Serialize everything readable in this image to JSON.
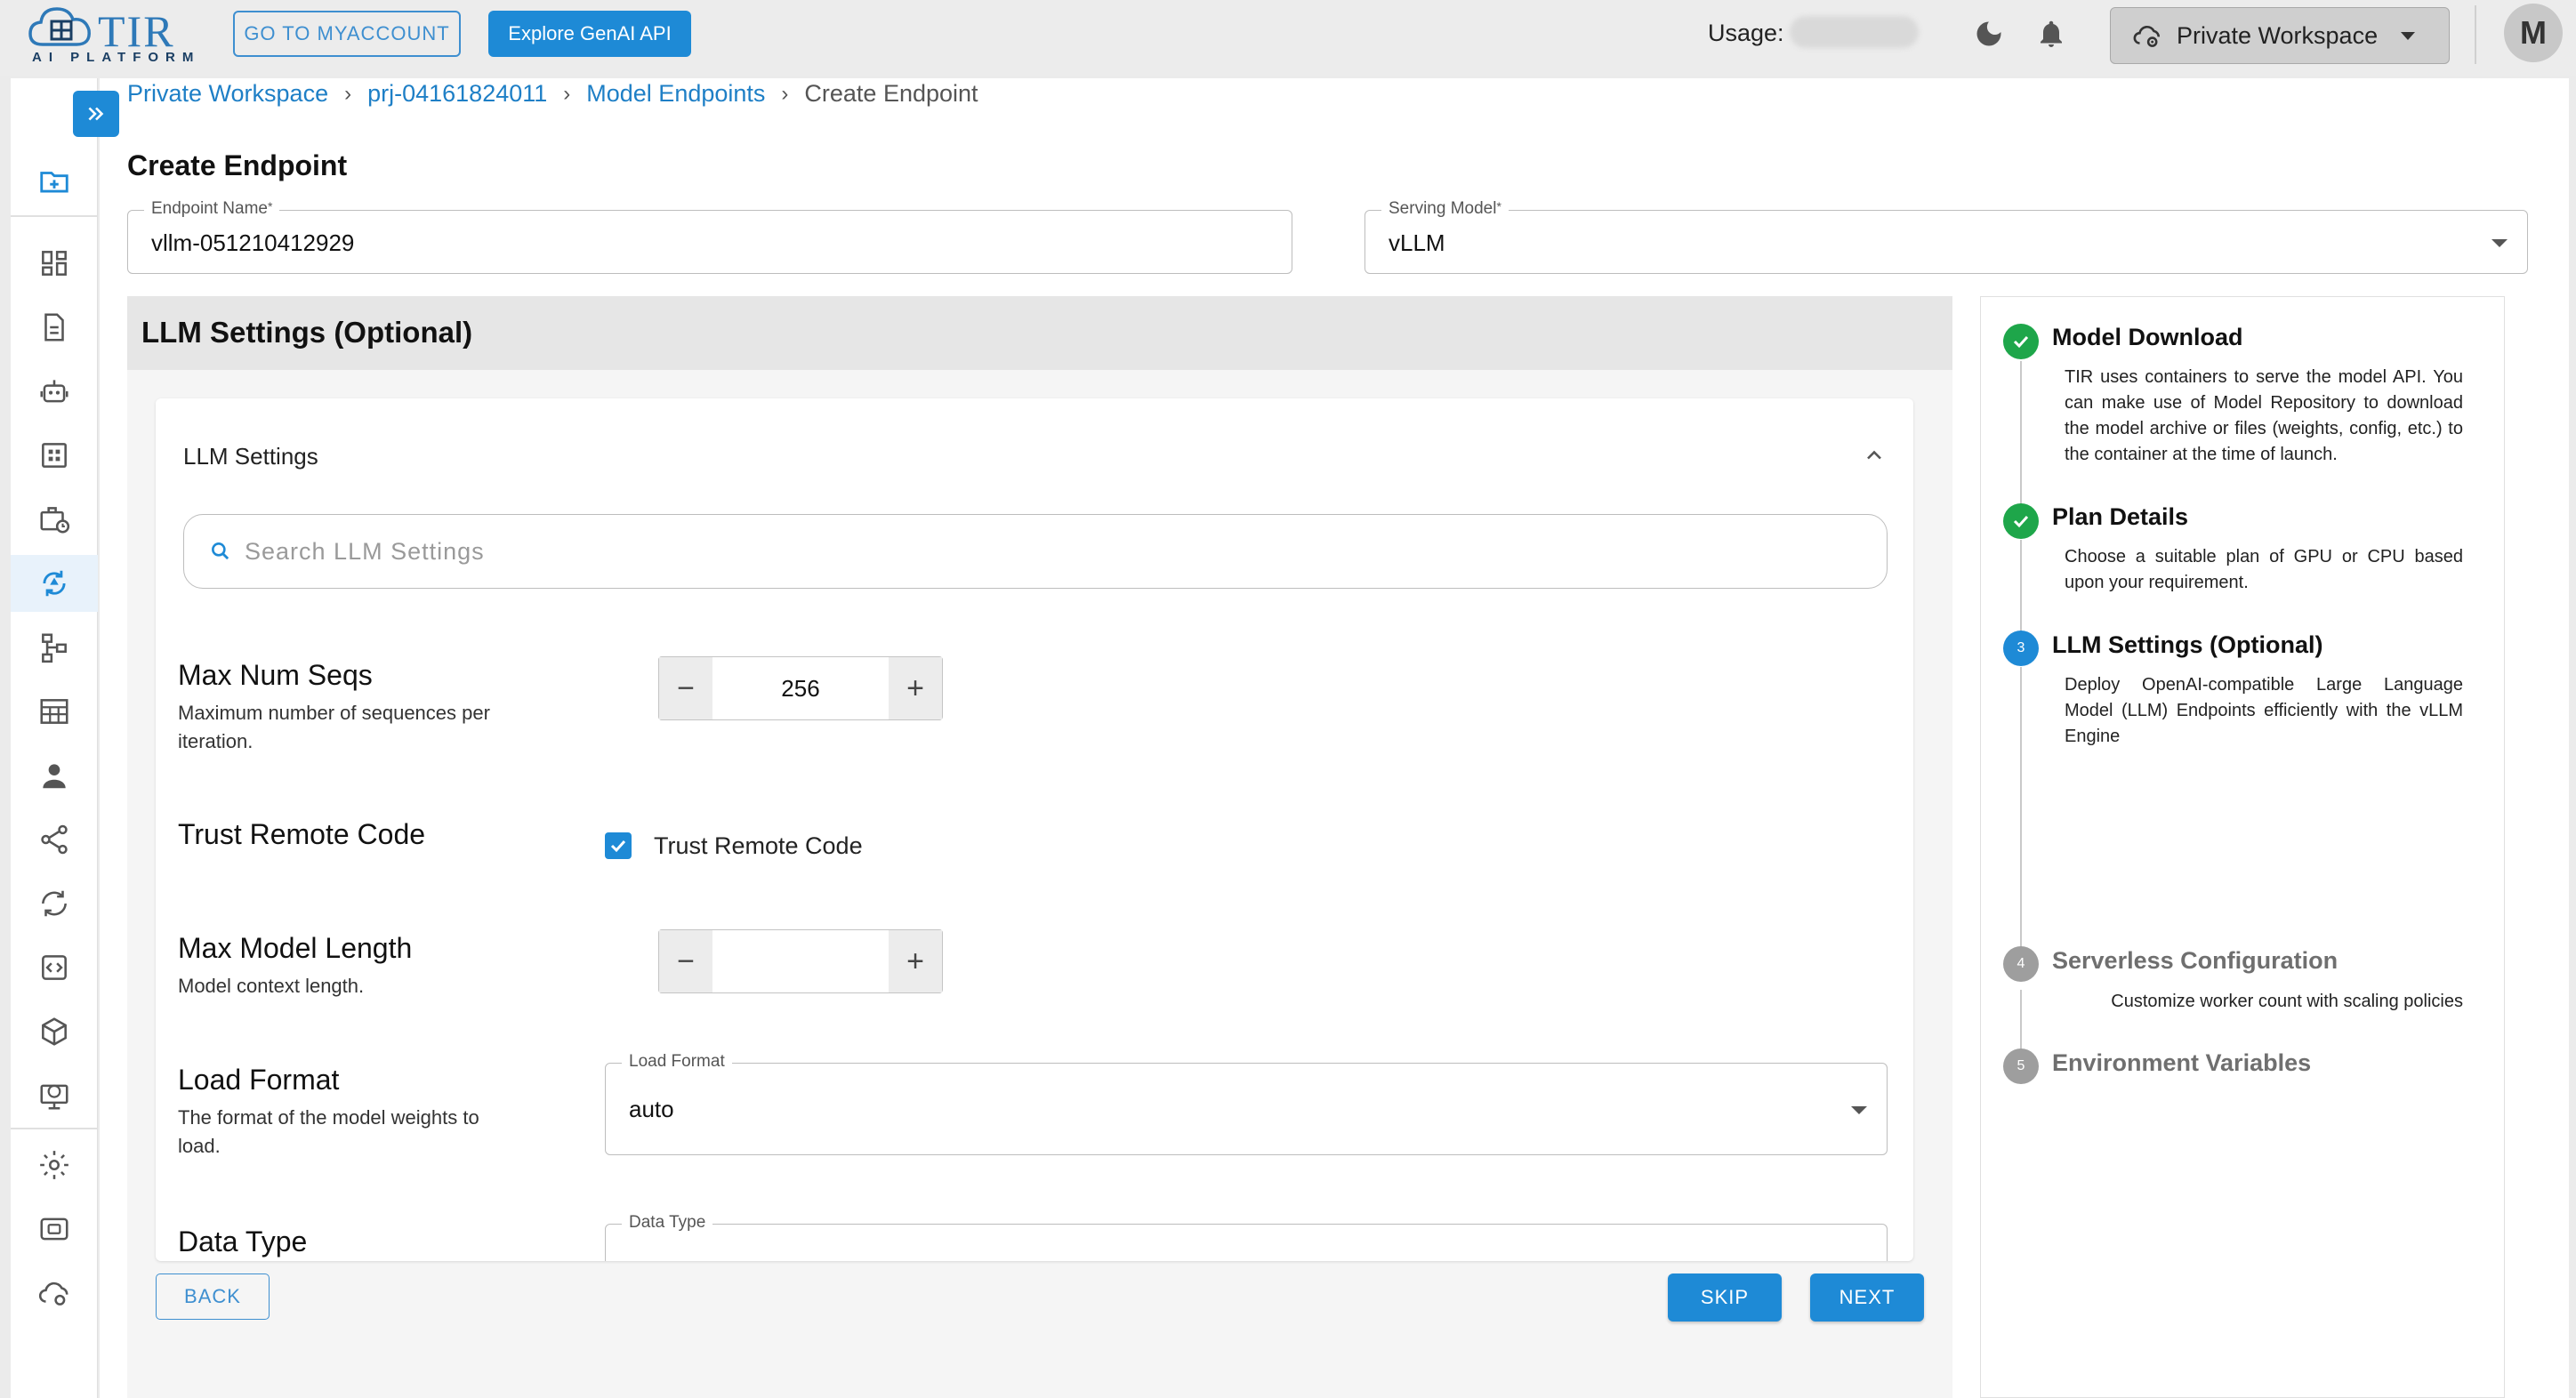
{
  "topbar": {
    "logo_title": "TIR",
    "logo_subtitle": "AI PLATFORM",
    "myaccount_label": "GO TO MYACCOUNT",
    "genai_label": "Explore GenAI API",
    "usage_label": "Usage:",
    "workspace_label": "Private Workspace",
    "avatar_initial": "M"
  },
  "sidebar": {
    "items": [
      {
        "icon": "new-folder-icon"
      },
      {
        "icon": "dashboard-icon"
      },
      {
        "icon": "document-icon"
      },
      {
        "icon": "robot-icon"
      },
      {
        "icon": "grid-icon"
      },
      {
        "icon": "briefcase-clock-icon"
      },
      {
        "icon": "model-endpoints-icon",
        "active": true
      },
      {
        "icon": "pipeline-icon"
      },
      {
        "icon": "table-icon"
      },
      {
        "icon": "user-badge-icon"
      },
      {
        "icon": "share-nodes-icon"
      },
      {
        "icon": "sync-icon"
      },
      {
        "icon": "code-box-icon"
      },
      {
        "icon": "cube-icon"
      },
      {
        "icon": "ip-monitor-icon"
      },
      {
        "icon": "settings-icon"
      },
      {
        "icon": "wallet-icon"
      },
      {
        "icon": "cloud-settings-icon"
      }
    ]
  },
  "breadcrumb": {
    "items": [
      "Private Workspace",
      "prj-04161824011",
      "Model Endpoints"
    ],
    "current": "Create Endpoint"
  },
  "page_title": "Create Endpoint",
  "form": {
    "endpoint_name_label": "Endpoint Name",
    "endpoint_name_value": "vllm-051210412929",
    "serving_model_label": "Serving Model",
    "serving_model_value": "vLLM",
    "required_mark": "*"
  },
  "llm_section": {
    "title": "LLM Settings (Optional)",
    "card_title": "LLM Settings",
    "search_placeholder": "Search LLM Settings",
    "settings": {
      "max_num_seqs": {
        "title": "Max Num Seqs",
        "desc": "Maximum number of sequences per iteration.",
        "value": "256"
      },
      "trust_remote_code": {
        "title": "Trust Remote Code",
        "checkbox_label": "Trust Remote Code",
        "checked": true
      },
      "max_model_length": {
        "title": "Max Model Length",
        "desc": "Model context length.",
        "value": ""
      },
      "load_format": {
        "title": "Load Format",
        "desc": "The format of the model weights to load.",
        "field_label": "Load Format",
        "value": "auto"
      },
      "data_type": {
        "title": "Data Type",
        "field_label": "Data Type"
      }
    }
  },
  "actions": {
    "back": "BACK",
    "skip": "SKIP",
    "next": "NEXT"
  },
  "stepper": {
    "steps": [
      {
        "title": "Model Download",
        "status": "done",
        "desc": "TIR uses containers to serve the model API. You can make use of Model Repository to download the model archive or files (weights, config, etc.) to the container at the time of launch."
      },
      {
        "title": "Plan Details",
        "status": "done",
        "desc": "Choose a suitable plan of GPU or CPU based upon your requirement."
      },
      {
        "title": "LLM Settings (Optional)",
        "status": "current",
        "number": "3",
        "desc": "Deploy OpenAI-compatible Large Language Model (LLM) Endpoints efficiently with the vLLM Engine"
      },
      {
        "title": "Serverless Configuration",
        "status": "todo",
        "number": "4",
        "desc": "Customize worker count with scaling policies"
      },
      {
        "title": "Environment Variables",
        "status": "todo",
        "number": "5",
        "desc": ""
      }
    ]
  },
  "colors": {
    "accent": "#1e8ad6",
    "link": "#1e7fc6",
    "success": "#1ea64a",
    "muted_step": "#9e9e9e"
  }
}
